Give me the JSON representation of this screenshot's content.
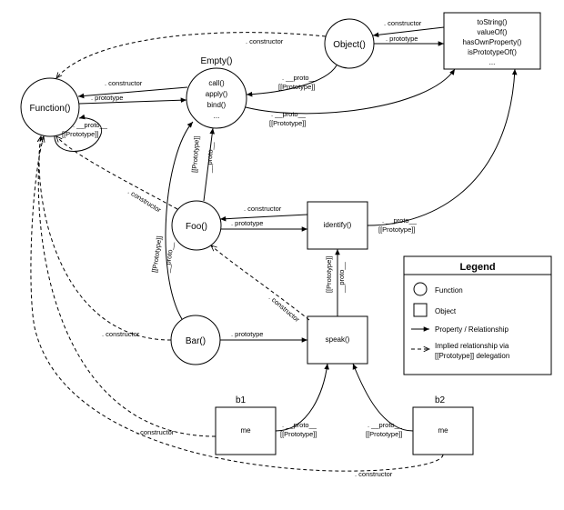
{
  "functions": {
    "function": "Function()",
    "empty": "Empty()",
    "object": "Object()",
    "foo": "Foo()",
    "bar": "Bar()"
  },
  "objects": {
    "objectProto": [
      "toString()",
      "valueOf()",
      "hasOwnProperty()",
      "isPrototypeOf()",
      "..."
    ],
    "emptyProto": [
      "call()",
      "apply()",
      "bind()",
      "..."
    ],
    "fooProto": "identify()",
    "barProto": "speak()",
    "b1Label": "b1",
    "b2Label": "b2",
    "me": "me"
  },
  "edges": {
    "constructor": ". constructor",
    "prototype": ". prototype",
    "proto": ". __proto__",
    "protoChain": "[[Prototype]]",
    "protoChainRot": "__proto__"
  },
  "legend": {
    "title": "Legend",
    "function": "Function",
    "object": "Object",
    "property": "Property / Relationship",
    "implied1": "Implied relationship via",
    "implied2": "[[Prototype]] delegation"
  }
}
